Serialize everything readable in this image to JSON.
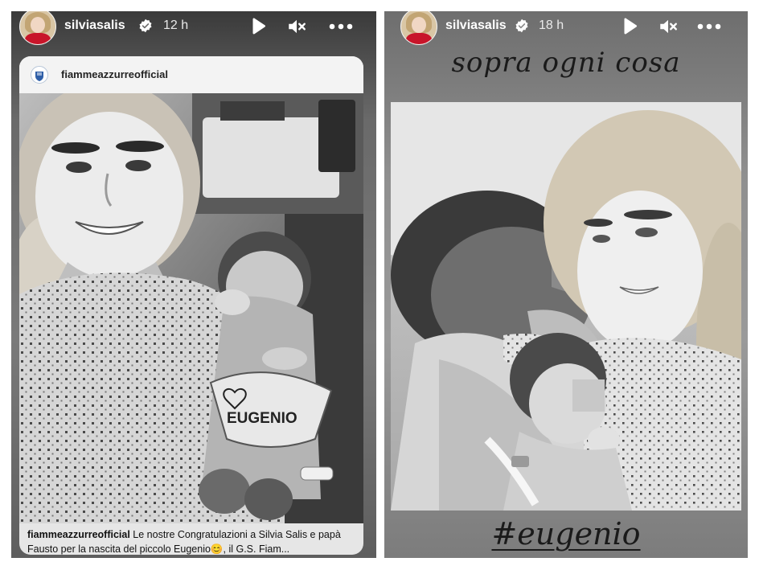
{
  "stories": [
    {
      "username": "silviasalis",
      "time": "12 h",
      "repost": {
        "account": "fiammeazzurreofficial",
        "caption_account": "fiammeazzurreofficial",
        "caption_text": " Le nostre Congratulazioni a Silvia Salis e papà Fausto per la nascita del piccolo Eugenio",
        "caption_emoji": "😊",
        "caption_tail": ", il G.S. Fiam...",
        "bib_label": "EUGENIO"
      },
      "icons": [
        "verified-badge-icon",
        "play-icon",
        "muted-speaker-icon",
        "more-options-icon"
      ]
    },
    {
      "username": "silviasalis",
      "time": "18 h",
      "headline": "sopra ogni cosa",
      "hashtag": "#eugenio",
      "icons": [
        "verified-badge-icon",
        "play-icon",
        "muted-speaker-icon",
        "more-options-icon"
      ]
    }
  ],
  "colors": {
    "verified": "#ffffff",
    "avatar_dress": "#c8152a",
    "card_bg": "#e6e6e6"
  }
}
